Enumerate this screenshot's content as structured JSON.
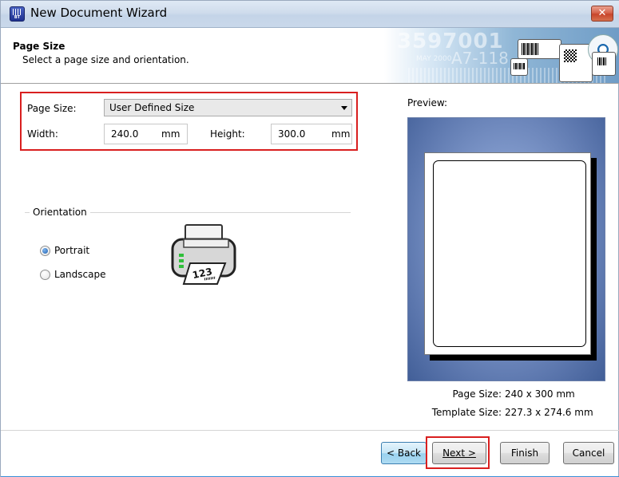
{
  "window": {
    "title": "New Document Wizard",
    "app_icon_text": "BT",
    "close_glyph": "✕"
  },
  "header": {
    "title": "Page Size",
    "subtitle": "Select a page size and orientation."
  },
  "form": {
    "page_size_label": "Page Size:",
    "page_size_value": "User Defined Size",
    "width_label": "Width:",
    "width_value": "240.0",
    "width_unit": "mm",
    "height_label": "Height:",
    "height_value": "300.0",
    "height_unit": "mm"
  },
  "orientation": {
    "group_title": "Orientation",
    "options": [
      {
        "label": "Portrait",
        "selected": true
      },
      {
        "label": "Landscape",
        "selected": false
      }
    ]
  },
  "preview": {
    "label": "Preview:",
    "page_size_label": "Page Size:",
    "page_size_value": "240 x 300 mm",
    "template_size_label": "Template Size:",
    "template_size_value": "227.3 x 274.6 mm"
  },
  "buttons": {
    "back": "< Back",
    "next": "Next >",
    "finish": "Finish",
    "cancel": "Cancel"
  },
  "colors": {
    "highlight": "#d91f1f",
    "preview_bg": "#5b76ad"
  },
  "icons": {
    "app": "app-icon",
    "close": "close-icon",
    "printer": "printer-icon",
    "dropdown": "chevron-down-icon"
  }
}
